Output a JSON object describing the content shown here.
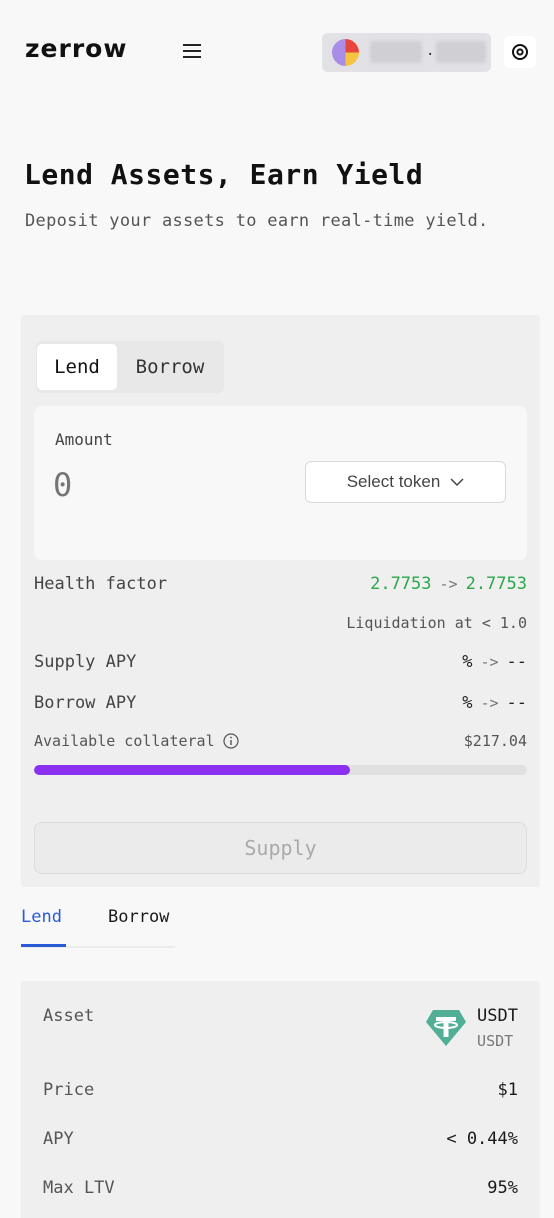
{
  "header": {
    "logo": "zerrow",
    "wallet_dot": "."
  },
  "hero": {
    "title": "Lend Assets, Earn Yield",
    "subtitle": "Deposit your assets to earn real-time yield."
  },
  "form": {
    "tabs": [
      "Lend",
      "Borrow"
    ],
    "active_tab": "Lend",
    "amount_label": "Amount",
    "amount_placeholder": "0",
    "select_token_label": "Select token",
    "health_factor": {
      "label": "Health factor",
      "current": "2.7753",
      "arrow": "->",
      "next": "2.7753"
    },
    "liquidation": "Liquidation at < 1.0",
    "supply_apy": {
      "label": "Supply APY",
      "current": "%",
      "arrow": "->",
      "next": "--"
    },
    "borrow_apy": {
      "label": "Borrow APY",
      "current": "%",
      "arrow": "->",
      "next": "--"
    },
    "available_collateral": {
      "label": "Available collateral",
      "value": "$217.04",
      "progress_fraction": 0.64
    },
    "submit_label": "Supply"
  },
  "market_tabs": [
    "Lend",
    "Borrow"
  ],
  "asset_info": {
    "asset_label": "Asset",
    "asset_name": "USDT",
    "asset_symbol": "USDT",
    "price_label": "Price",
    "price": "$1",
    "apy_label": "APY",
    "apy": "< 0.44%",
    "max_ltv_label": "Max LTV",
    "max_ltv": "95%"
  },
  "colors": {
    "accent_purple": "#8b2ff0",
    "positive_green": "#2aa84a",
    "tab_blue": "#2a5bd7",
    "tether_green": "#50af95"
  }
}
